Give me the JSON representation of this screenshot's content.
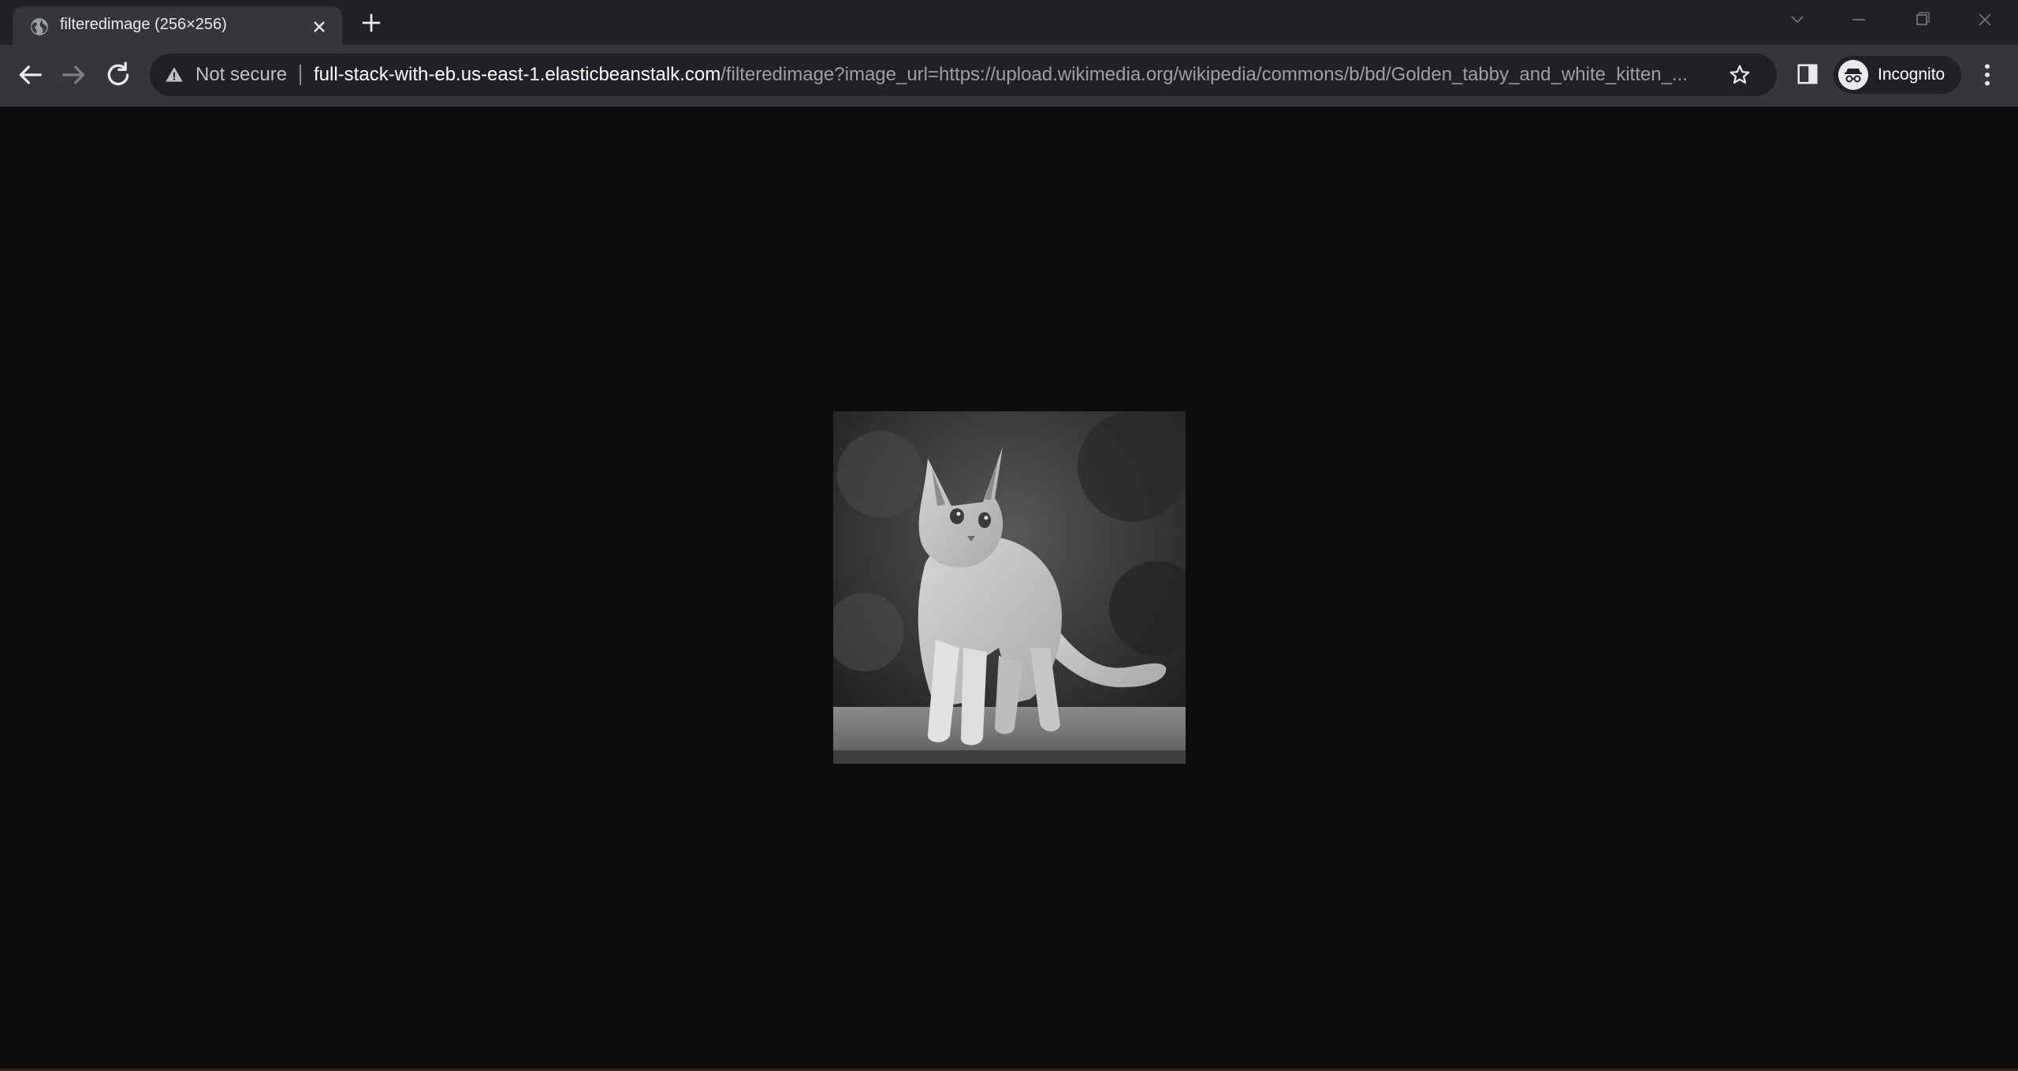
{
  "tab": {
    "title": "filteredimage (256×256)",
    "favicon": "globe-icon"
  },
  "toolbar": {
    "security_label": "Not secure",
    "url_host": "full-stack-with-eb.us-east-1.elasticbeanstalk.com",
    "url_path": "/filteredimage?image_url=https://upload.wikimedia.org/wikipedia/commons/b/bd/Golden_tabby_and_white_kitten_...",
    "profile_label": "Incognito"
  },
  "content": {
    "image_alt": "grayscale kitten"
  },
  "colors": {
    "tabstrip": "#202124",
    "toolbar": "#35363a",
    "page_background": "#0e0e0e"
  }
}
